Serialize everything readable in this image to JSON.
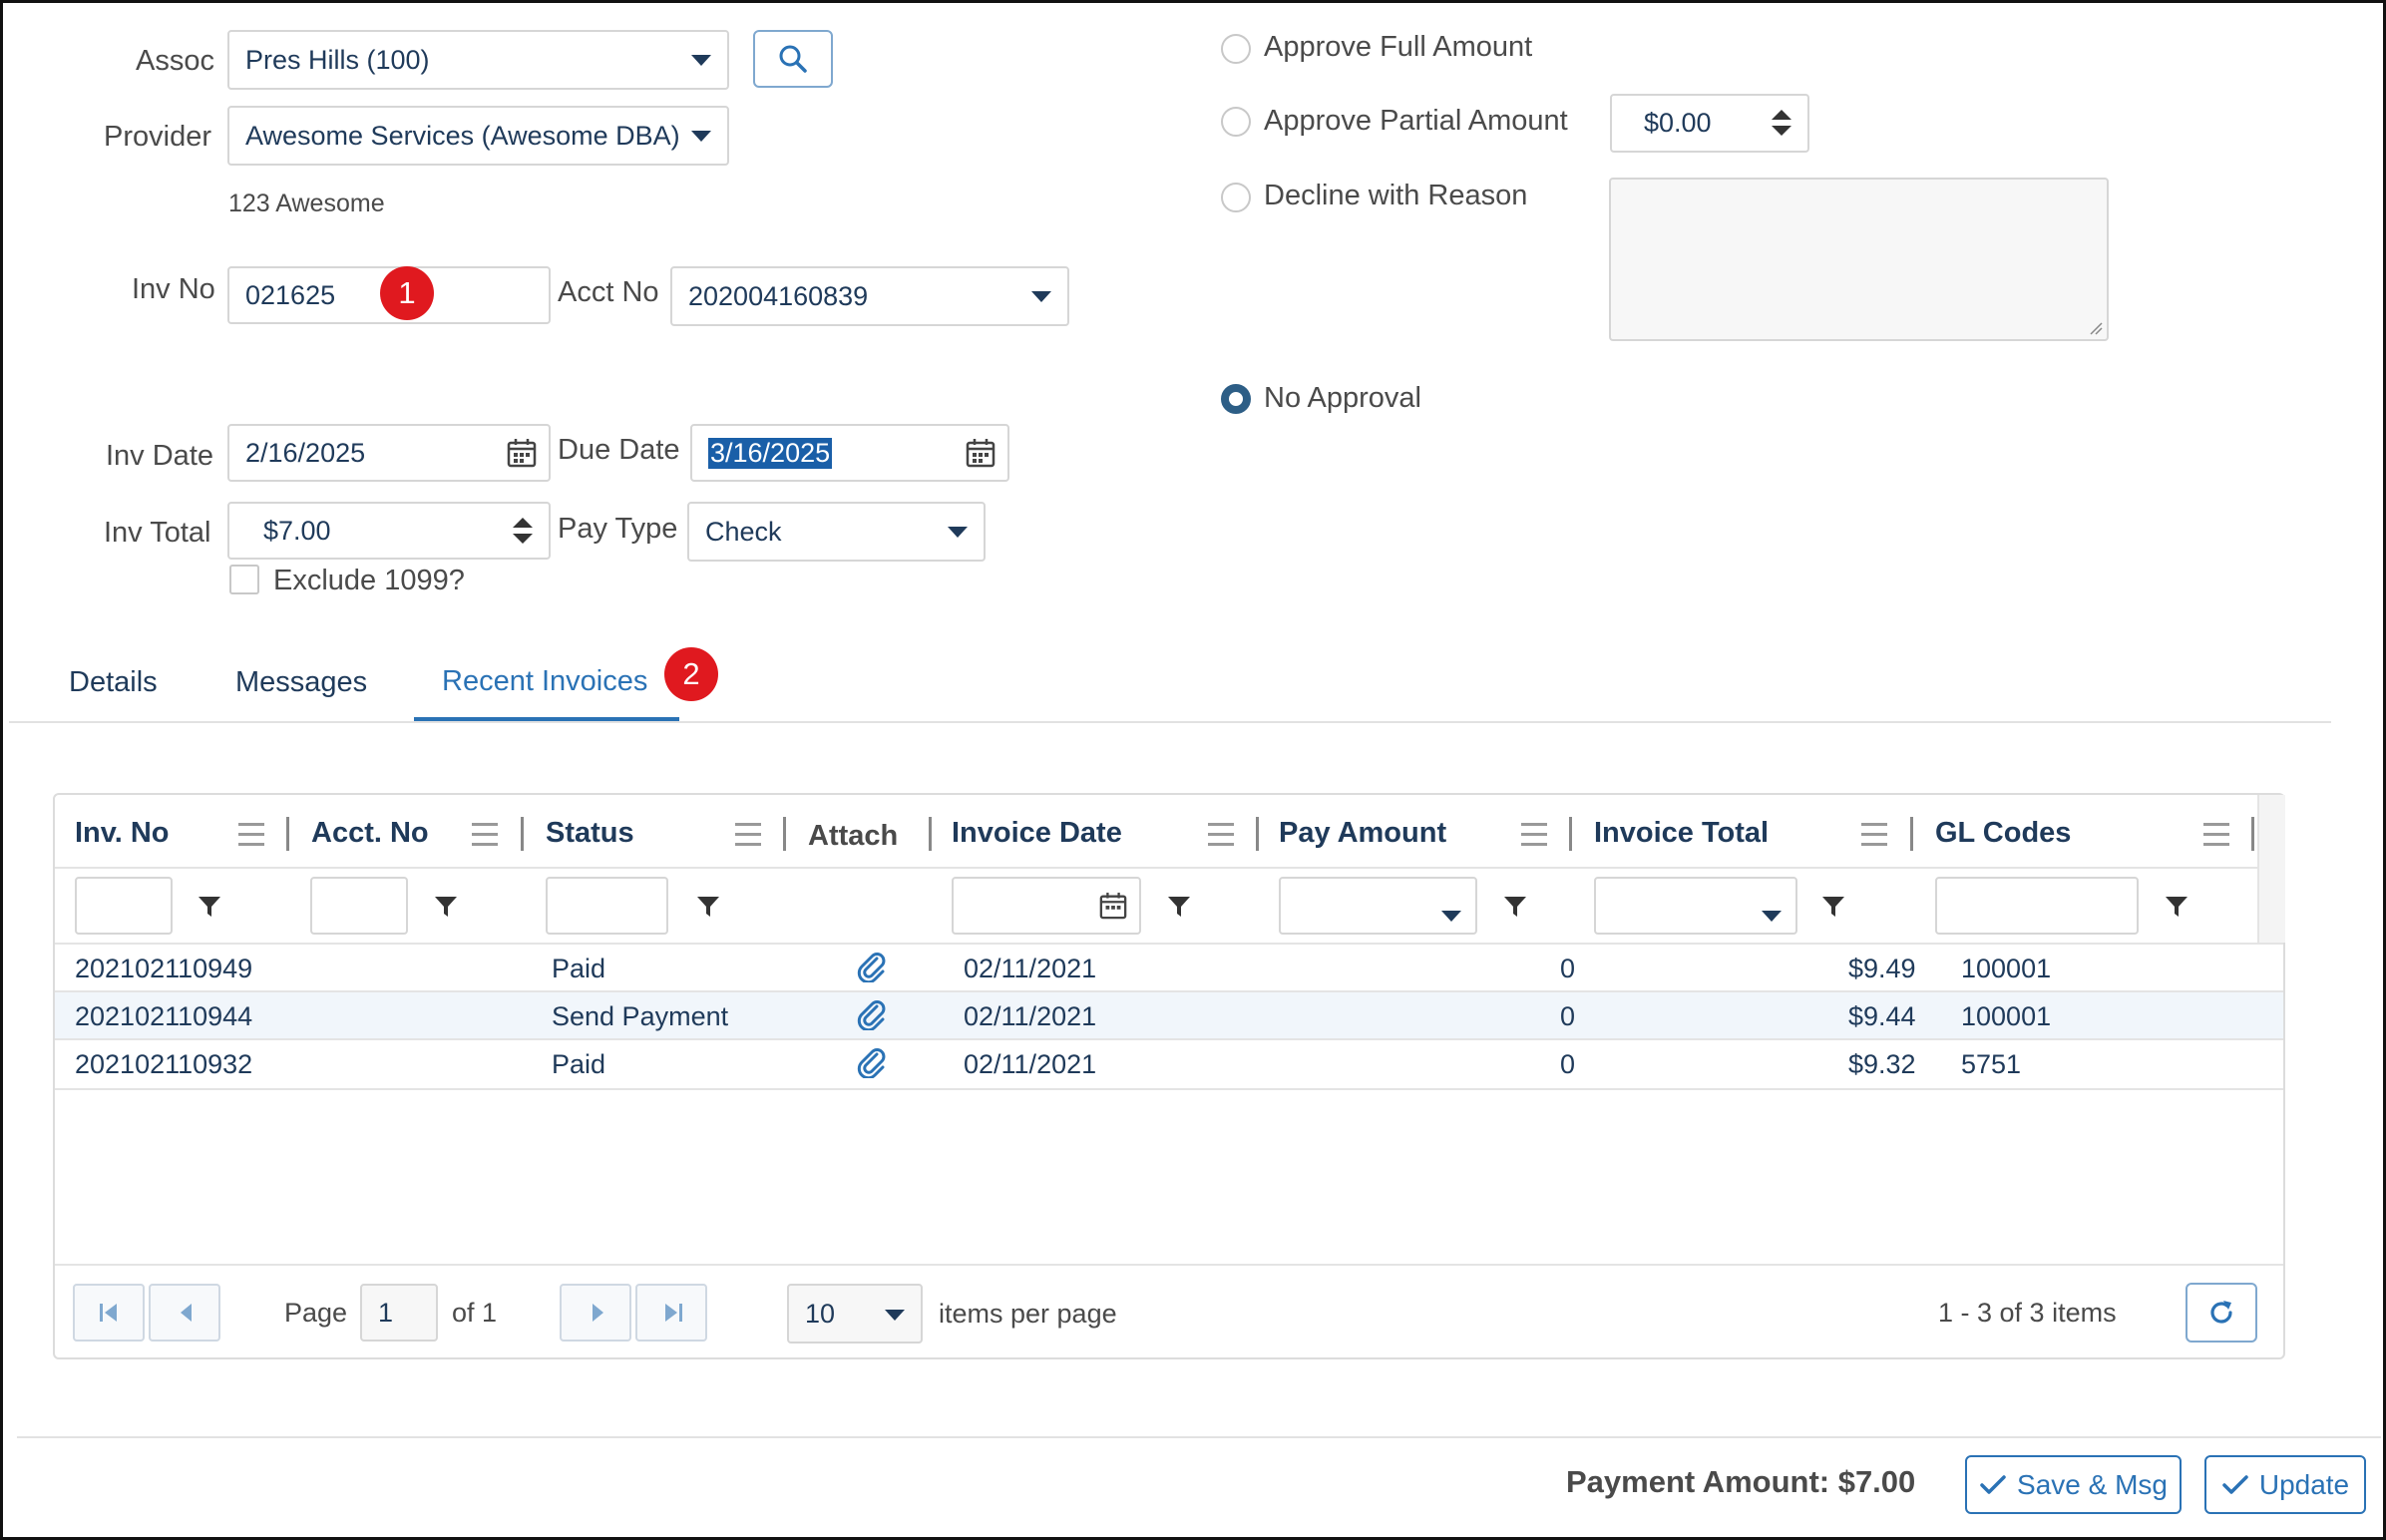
{
  "form": {
    "assoc_label": "Assoc",
    "assoc_value": "Pres Hills (100)",
    "provider_label": "Provider",
    "provider_value": "Awesome Services (Awesome DBA)",
    "provider_address": "123 Awesome",
    "inv_no_label": "Inv No",
    "inv_no_value": "021625",
    "acct_no_label": "Acct No",
    "acct_no_value": "202004160839",
    "inv_date_label": "Inv Date",
    "inv_date_value": "2/16/2025",
    "due_date_label": "Due Date",
    "due_date_value": "3/16/2025",
    "inv_total_label": "Inv Total",
    "inv_total_value": "$7.00",
    "pay_type_label": "Pay Type",
    "pay_type_value": "Check",
    "exclude_1099_label": "Exclude 1099?"
  },
  "approval": {
    "full_label": "Approve Full Amount",
    "partial_label": "Approve Partial Amount",
    "partial_value": "$0.00",
    "decline_label": "Decline with Reason",
    "none_label": "No Approval",
    "selected": "none"
  },
  "badges": [
    "1",
    "2"
  ],
  "tabs": [
    {
      "label": "Details"
    },
    {
      "label": "Messages"
    },
    {
      "label": "Recent Invoices",
      "active": true
    }
  ],
  "grid": {
    "columns": [
      "Inv. No",
      "Acct. No",
      "Status",
      "Attach",
      "Invoice Date",
      "Pay Amount",
      "Invoice Total",
      "GL Codes"
    ],
    "rows": [
      {
        "inv_no": "202102110949",
        "acct_no": "",
        "status": "Paid",
        "attach": "paperclip-icon",
        "invoice_date": "02/11/2021",
        "pay_amount": "0",
        "invoice_total": "$9.49",
        "gl_codes": "100001"
      },
      {
        "inv_no": "202102110944",
        "acct_no": "",
        "status": "Send Payment",
        "attach": "paperclip-icon",
        "invoice_date": "02/11/2021",
        "pay_amount": "0",
        "invoice_total": "$9.44",
        "gl_codes": "100001"
      },
      {
        "inv_no": "202102110932",
        "acct_no": "",
        "status": "Paid",
        "attach": "paperclip-icon",
        "invoice_date": "02/11/2021",
        "pay_amount": "0",
        "invoice_total": "$9.32",
        "gl_codes": "5751"
      }
    ]
  },
  "pager": {
    "page_label": "Page",
    "page_value": "1",
    "of_label": "of 1",
    "page_size": "10",
    "items_per_page_label": "items per page",
    "summary": "1 - 3 of 3 items"
  },
  "footer": {
    "payment_amount": "Payment Amount: $7.00",
    "save_msg_label": "Save & Msg",
    "update_label": "Update"
  },
  "colors": {
    "accent": "#2a72b5",
    "text_dark": "#1f3a5a",
    "badge": "#e0191f",
    "row_highlight": "#f1f6fb"
  }
}
